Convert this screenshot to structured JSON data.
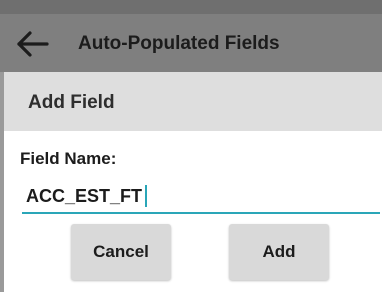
{
  "app_bar": {
    "title": "Auto-Populated Fields",
    "back_icon": "back-arrow-icon",
    "background_color": "#7f7f7f"
  },
  "dialog": {
    "title": "Add Field",
    "field_label": "Field Name:",
    "field_value": "ACC_EST_FT",
    "accent_color": "#2aa6b8",
    "cancel_label": "Cancel",
    "add_label": "Add"
  }
}
